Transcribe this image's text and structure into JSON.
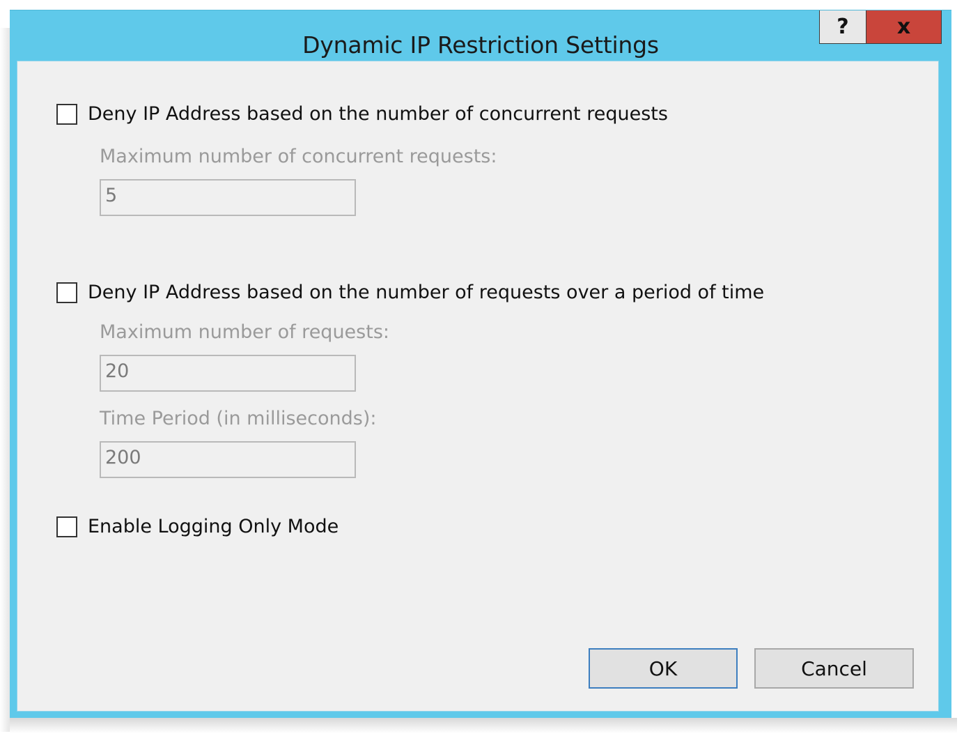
{
  "window": {
    "title": "Dynamic IP Restriction Settings",
    "help_label": "?",
    "close_label": "x"
  },
  "concurrent": {
    "checkbox_label": "Deny IP Address based on the number of concurrent requests",
    "checked": false,
    "max_label": "Maximum number of concurrent requests:",
    "max_value": "5"
  },
  "rate": {
    "checkbox_label": "Deny IP Address based on the number of requests over a period of time",
    "checked": false,
    "max_label": "Maximum number of requests:",
    "max_value": "20",
    "period_label": "Time Period (in milliseconds):",
    "period_value": "200"
  },
  "logging": {
    "checkbox_label": "Enable Logging Only Mode",
    "checked": false
  },
  "buttons": {
    "ok_label": "OK",
    "cancel_label": "Cancel"
  },
  "colors": {
    "titlebar": "#5fc9ea",
    "close_button": "#c9453b",
    "client_background": "#f0f0f0",
    "default_button_border": "#3d7ebf"
  }
}
